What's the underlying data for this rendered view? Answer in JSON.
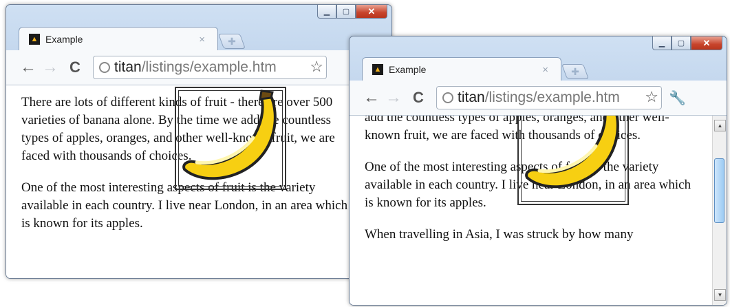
{
  "windows": [
    {
      "tab_title": "Example",
      "url_host": "titan",
      "url_path": "/listings/example.htm",
      "paragraphs": [
        "There are lots of different kinds of fruit - there are over 500 varieties of banana alone. By the time we add the countless types of apples, oranges, and other well-known fruit, we are faced with thousands of choices.",
        "One of the most interesting aspects of fruit is the variety available in each country. I live near London, in an area which is known for its apples."
      ]
    },
    {
      "tab_title": "Example",
      "url_host": "titan",
      "url_path": "/listings/example.htm",
      "paragraphs": [
        "add the countless types of apples, oranges, and other well-known fruit, we are faced with thousands of choices.",
        "One of the most interesting aspects of fruit is the variety available in each country. I live near London, in an area which is known for its apples.",
        "When travelling in Asia, I was struck by how many"
      ]
    }
  ],
  "icons": {
    "minimize": "minimize-icon",
    "maximize": "maximize-icon",
    "close": "close-icon",
    "back": "back-arrow-icon",
    "forward": "forward-arrow-icon",
    "reload": "reload-icon",
    "bookmark": "star-icon",
    "wrench": "wrench-icon"
  },
  "colors": {
    "frame": "#bcd1ea",
    "close_button": "#c7442c",
    "banana_fill": "#f7cf12",
    "scroll_thumb": "#9ccbf3"
  }
}
